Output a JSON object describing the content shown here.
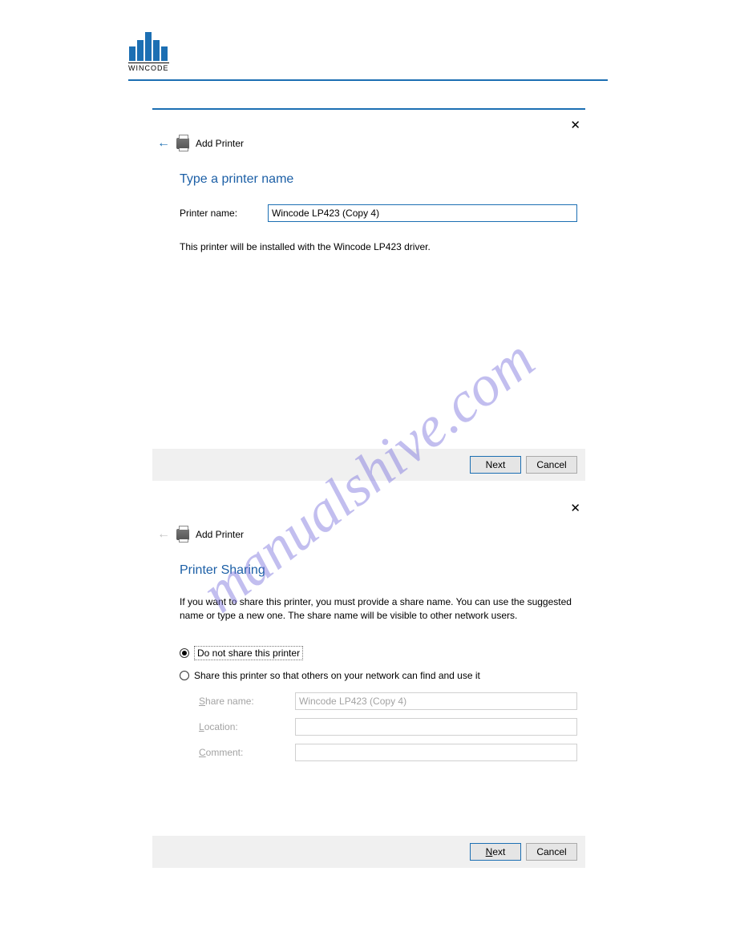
{
  "brand": {
    "name": "WINCODE"
  },
  "watermark": "manualshive.com",
  "dialog1": {
    "title": "Add Printer",
    "heading": "Type a printer name",
    "printer_name_label": "Printer name:",
    "printer_name_value": "Wincode LP423 (Copy 4)",
    "info": "This printer will be installed with the Wincode LP423 driver.",
    "buttons": {
      "next": "Next",
      "cancel": "Cancel"
    }
  },
  "dialog2": {
    "title": "Add Printer",
    "heading": "Printer Sharing",
    "description": "If you want to share this printer, you must provide a share name. You can use the suggested name or type a new one. The share name will be visible to other network users.",
    "option_do_not_share": "Do not share this printer",
    "option_share": "Share this printer so that others on your network can find and use it",
    "share_name_label": "Share name:",
    "share_name_value": "Wincode LP423 (Copy 4)",
    "location_label": "Location:",
    "location_value": "",
    "comment_label": "Comment:",
    "comment_value": "",
    "buttons": {
      "next": "Next",
      "cancel": "Cancel"
    }
  }
}
